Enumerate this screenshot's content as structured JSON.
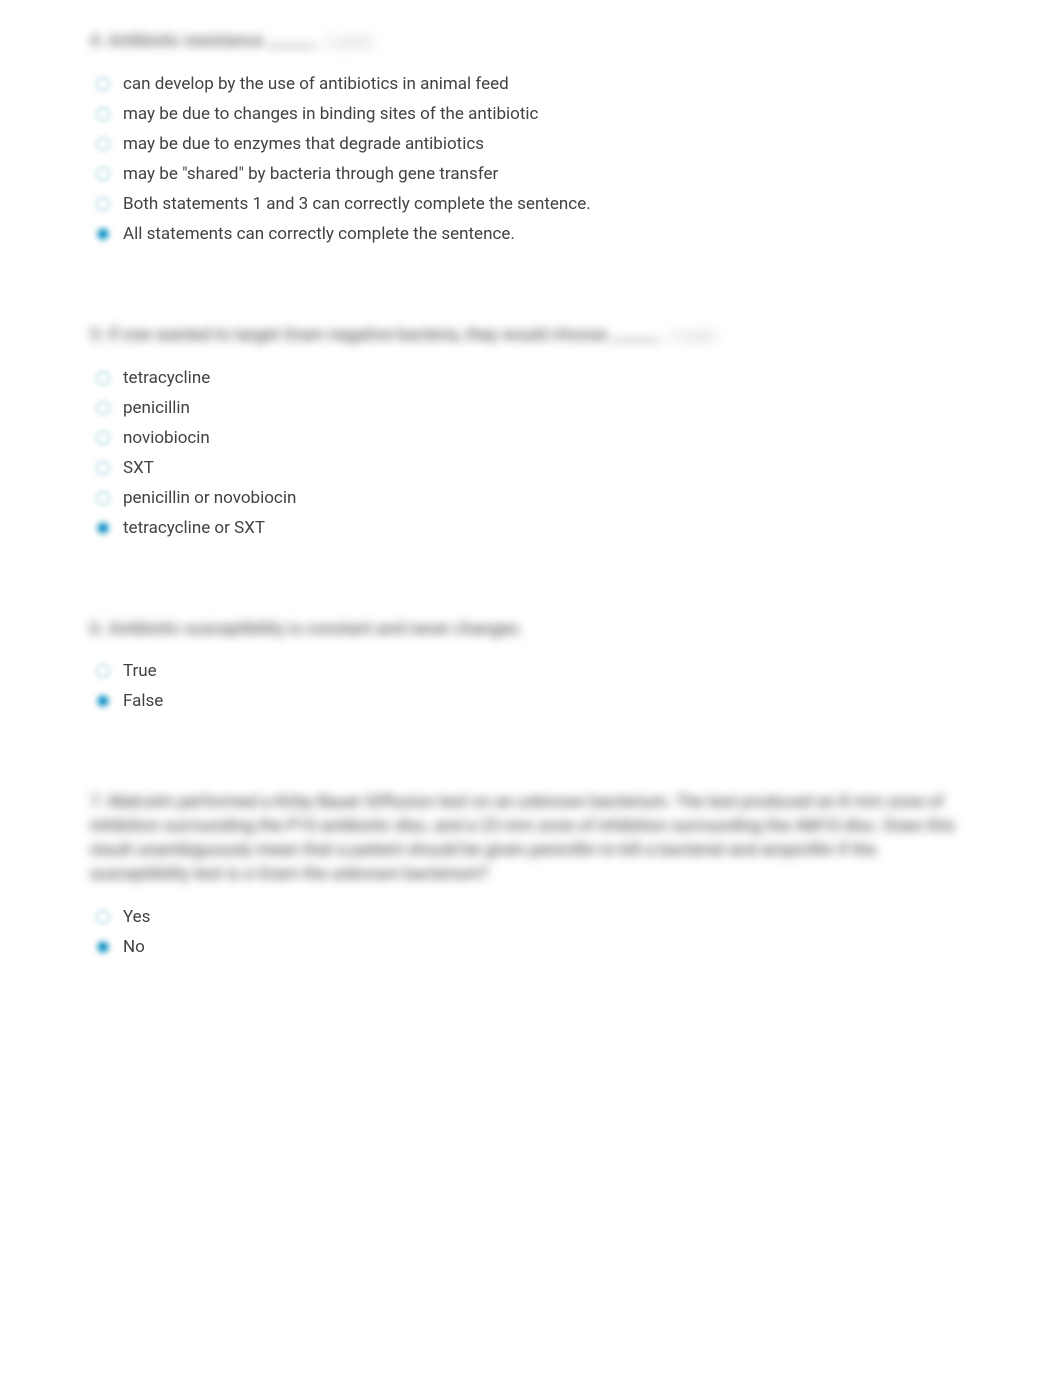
{
  "questions": [
    {
      "number": "4",
      "text": "Antibiotic resistance ______.",
      "points": "(1 point)",
      "options": [
        "can develop by the use of antibiotics in animal feed",
        "may be due to changes in binding sites of the antibiotic",
        "may be due to enzymes that degrade antibiotics",
        "may be \"shared\" by bacteria through gene transfer",
        "Both statements 1 and 3 can correctly complete the sentence.",
        "All statements can correctly complete the sentence."
      ],
      "selected": 5
    },
    {
      "number": "5",
      "text": "If one wanted to target Gram negative bacteria, they would choose ______.",
      "points": "(1 point)",
      "options": [
        "tetracycline",
        "penicillin",
        "noviobiocin",
        "SXT",
        "penicillin or novobiocin",
        "tetracycline or SXT"
      ],
      "selected": 5
    },
    {
      "number": "6",
      "text": "Antibiotic susceptibility is constant and never changes.",
      "points": "",
      "options": [
        "True",
        "False"
      ],
      "selected": 1
    },
    {
      "number": "7",
      "text": "Malcolm performed a Kirby Bauer Diffusion test on an unknown bacterium. The test produced an 8 mm zone of inhibition surrounding the P10 antibiotic disc, and a 23 mm zone of inhibition surrounding the AM10 disc. Does this result unambiguously mean that a patient should be given penicillin to kill a bacterial and ampicillin if the susceptibility test is a Gram the unknown bacterium?",
      "points": "",
      "options": [
        "Yes",
        "No"
      ],
      "selected": 1
    }
  ]
}
